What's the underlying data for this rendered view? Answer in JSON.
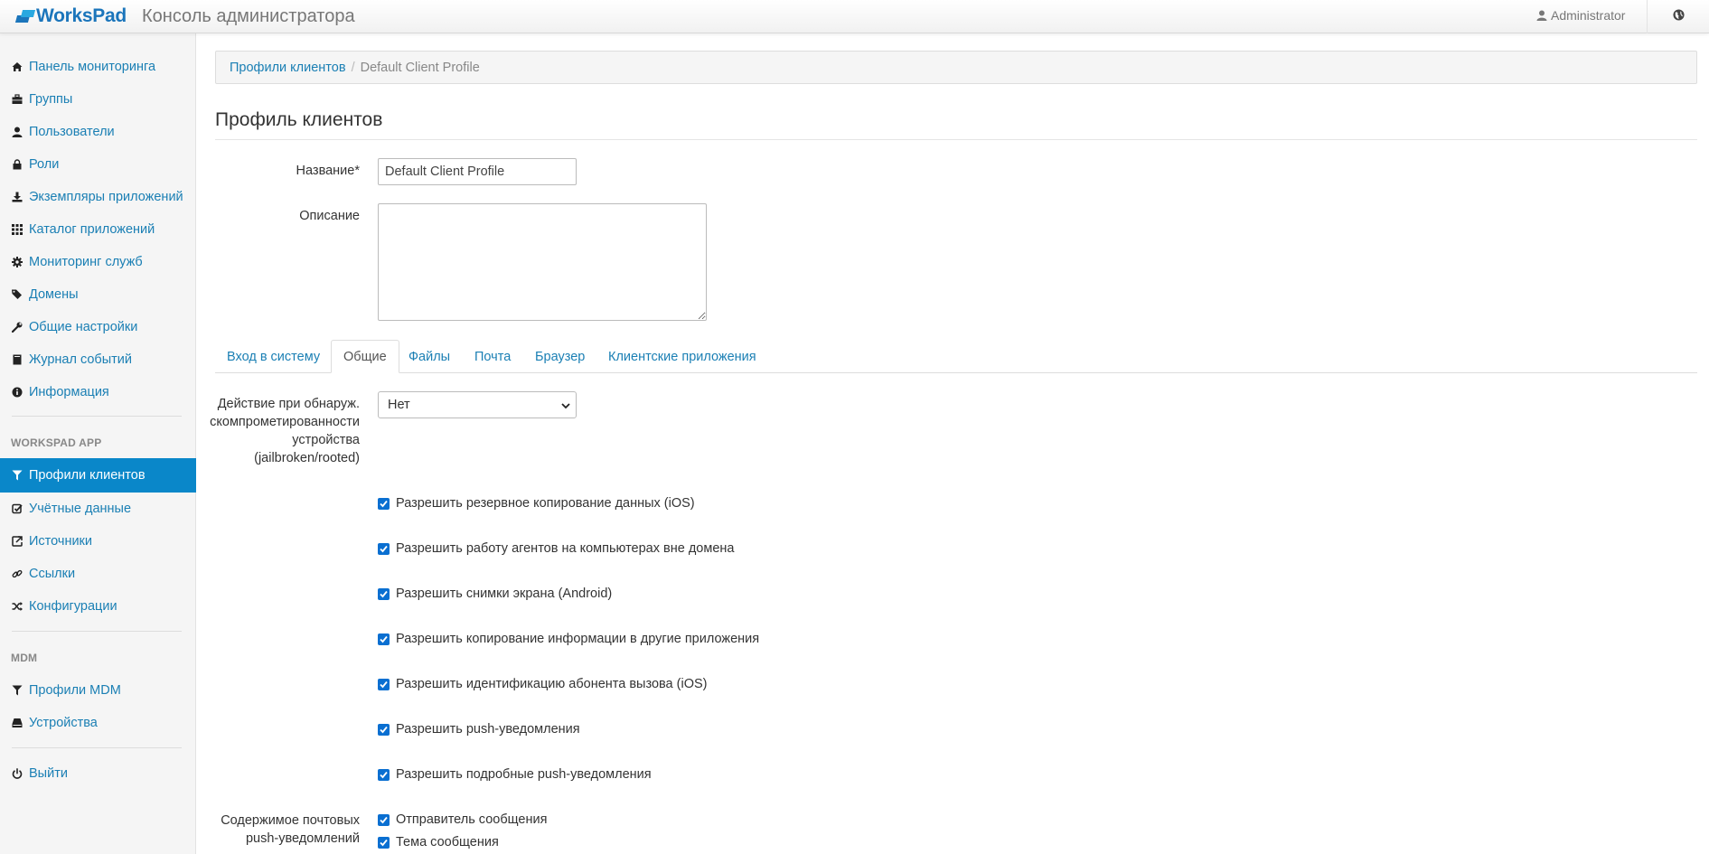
{
  "header": {
    "logo_text": "WorksPad",
    "app_title": "Консоль администратора",
    "user_name": "Administrator"
  },
  "sidebar": {
    "items_main": [
      {
        "label": "Панель мониторинга",
        "icon": "home-icon"
      },
      {
        "label": "Группы",
        "icon": "briefcase-icon"
      },
      {
        "label": "Пользователи",
        "icon": "user-icon"
      },
      {
        "label": "Роли",
        "icon": "lock-icon"
      },
      {
        "label": "Экземпляры приложений",
        "icon": "download-icon"
      },
      {
        "label": "Каталог приложений",
        "icon": "grid-icon"
      },
      {
        "label": "Мониторинг служб",
        "icon": "cog-icon"
      },
      {
        "label": "Домены",
        "icon": "tags-icon"
      },
      {
        "label": "Общие настройки",
        "icon": "wrench-icon"
      },
      {
        "label": "Журнал событий",
        "icon": "book-icon"
      },
      {
        "label": "Информация",
        "icon": "info-icon"
      }
    ],
    "section_workspad": "WORKSPAD APP",
    "items_workspad": [
      {
        "label": "Профили клиентов",
        "icon": "filter-icon",
        "active": true
      },
      {
        "label": "Учётные данные",
        "icon": "check-square-icon"
      },
      {
        "label": "Источники",
        "icon": "share-icon"
      },
      {
        "label": "Ссылки",
        "icon": "link-icon"
      },
      {
        "label": "Конфигурации",
        "icon": "random-icon"
      }
    ],
    "section_mdm": "MDM",
    "items_mdm": [
      {
        "label": "Профили MDM",
        "icon": "filter-icon"
      },
      {
        "label": "Устройства",
        "icon": "hdd-icon"
      }
    ],
    "logout": {
      "label": "Выйти",
      "icon": "power-icon"
    }
  },
  "breadcrumb": {
    "parent": "Профили клиентов",
    "current": "Default Client Profile"
  },
  "page": {
    "title": "Профиль клиентов",
    "name_label": "Название*",
    "name_value": "Default Client Profile",
    "description_label": "Описание",
    "description_value": ""
  },
  "tabs": [
    {
      "label": "Вход в систему"
    },
    {
      "label": "Общие",
      "active": true
    },
    {
      "label": "Файлы"
    },
    {
      "label": "Почта"
    },
    {
      "label": "Браузер"
    },
    {
      "label": "Клиентские приложения"
    }
  ],
  "general": {
    "jailbreak_label_lines": [
      "Действие при обнаруж.",
      "скомпрометированности",
      "устройства",
      "(jailbroken/rooted)"
    ],
    "jailbreak_value": "Нет",
    "checkboxes": [
      {
        "label": "Разрешить резервное копирование данных (iOS)",
        "checked": true
      },
      {
        "label": "Разрешить работу агентов на компьютерах вне домена",
        "checked": true
      },
      {
        "label": "Разрешить снимки экрана (Android)",
        "checked": true
      },
      {
        "label": "Разрешить копирование информации в другие приложения",
        "checked": true
      },
      {
        "label": "Разрешить идентификацию абонента вызова (iOS)",
        "checked": true
      },
      {
        "label": "Разрешить push-уведомления",
        "checked": true
      },
      {
        "label": "Разрешить подробные push-уведомления",
        "checked": true
      }
    ],
    "mail_push_label_lines": [
      "Содержимое почтовых",
      "push-уведомлений"
    ],
    "mail_push_options": [
      {
        "label": "Отправитель сообщения",
        "checked": true
      },
      {
        "label": "Тема сообщения",
        "checked": true
      }
    ]
  },
  "colors": {
    "accent": "#0a87c9",
    "link": "#1a7fb4",
    "checkbox": "#0a6fd1"
  }
}
